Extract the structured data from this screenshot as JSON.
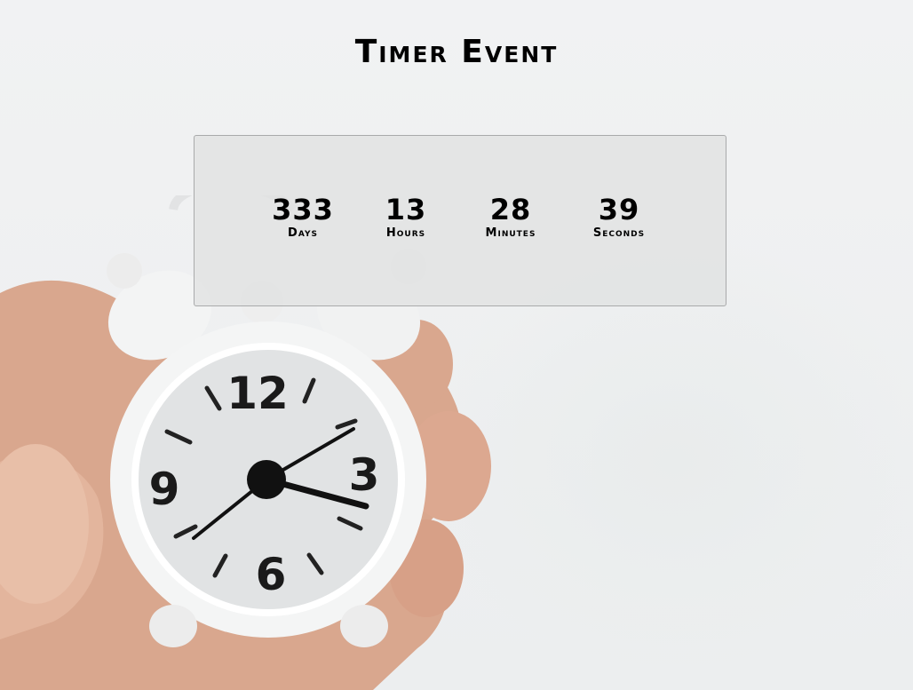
{
  "page": {
    "title": "Timer Event"
  },
  "countdown": {
    "days": {
      "value": "333",
      "label": "Days"
    },
    "hours": {
      "value": "13",
      "label": "Hours"
    },
    "minutes": {
      "value": "28",
      "label": "Minutes"
    },
    "seconds": {
      "value": "39",
      "label": "Seconds"
    }
  },
  "background": {
    "image": "alarm-clock-in-hand",
    "clock_numerals": [
      "12",
      "3",
      "6",
      "9"
    ]
  }
}
